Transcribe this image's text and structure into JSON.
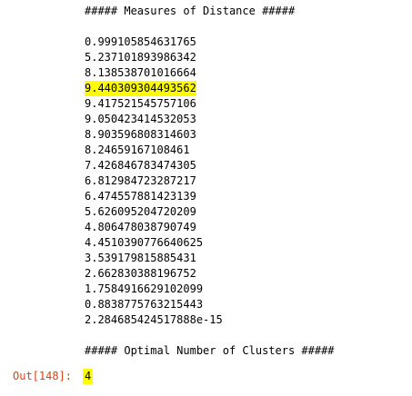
{
  "stream": {
    "header": "##### Measures of Distance #####",
    "values": [
      "0.999105854631765",
      "5.237101893986342",
      "8.138538701016664",
      "9.440309304493562",
      "9.417521545757106",
      "9.050423414532053",
      "8.903596808314603",
      "8.24659167108461",
      "7.426846783474305",
      "6.812984723287217",
      "6.474557881423139",
      "5.626095204720209",
      "4.806478038790749",
      "4.4510390776640625",
      "3.539179815885431",
      "2.662830388196752",
      "1.7584916629102099",
      "0.8838775763215443",
      "2.284685424517888e-15"
    ],
    "footer": "##### Optimal Number of Clusters #####"
  },
  "result": {
    "prompt": "Out[148]:",
    "value": "4"
  },
  "colors": {
    "highlight": "#ffff00",
    "prompt": "#d84315"
  }
}
